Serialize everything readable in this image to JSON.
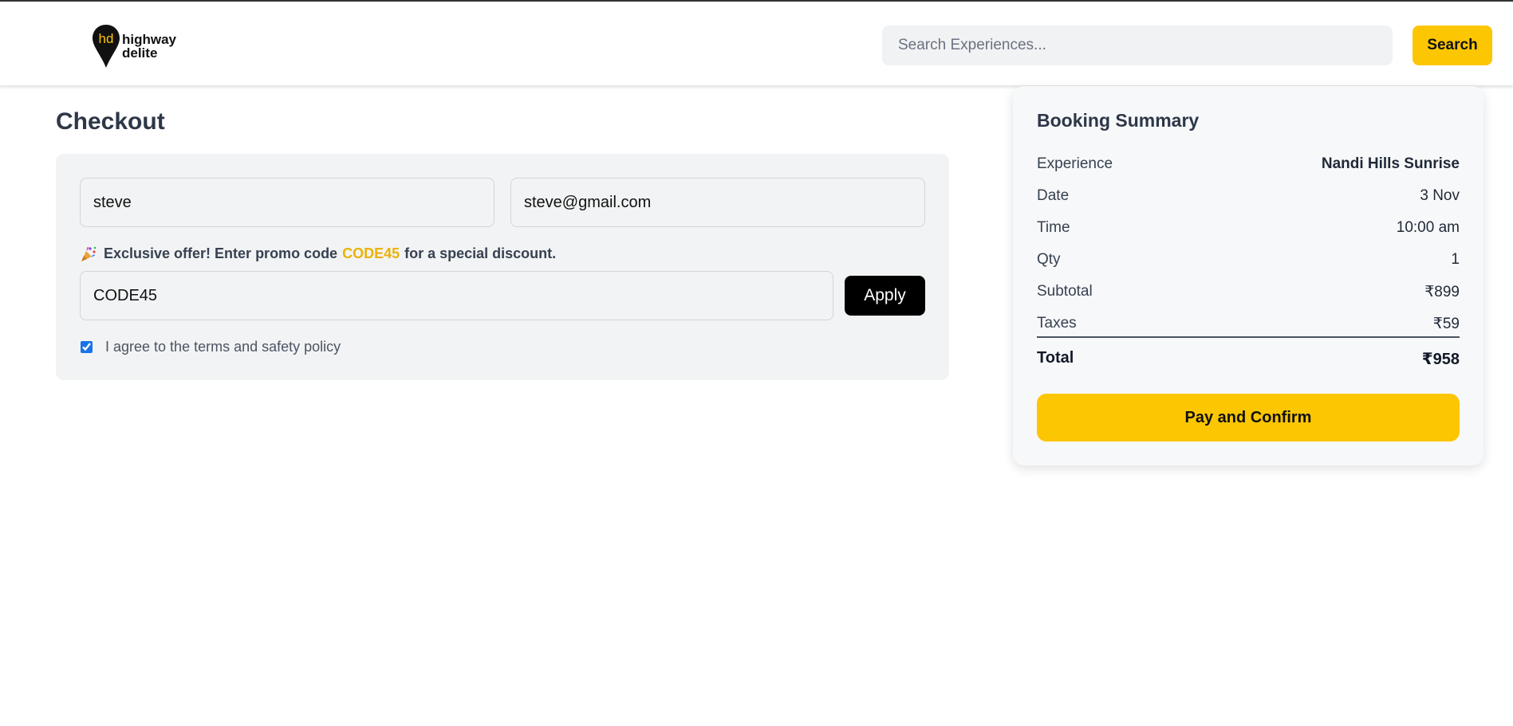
{
  "header": {
    "logo_line1": "highway",
    "logo_line2": "delite",
    "logo_mark": "hd",
    "search_placeholder": "Search Experiences...",
    "search_button_label": "Search"
  },
  "checkout": {
    "title": "Checkout",
    "name_value": "steve",
    "email_value": "steve@gmail.com",
    "promo_note_prefix": "Exclusive offer! Enter promo code",
    "promo_note_code": "CODE45",
    "promo_note_suffix": "for a special discount.",
    "promo_value": "CODE45",
    "apply_label": "Apply",
    "agree_label": "I agree to the terms and safety policy",
    "agree_checked": true
  },
  "summary": {
    "title": "Booking Summary",
    "rows": [
      {
        "label": "Experience",
        "value": "Nandi Hills Sunrise"
      },
      {
        "label": "Date",
        "value": "3 Nov"
      },
      {
        "label": "Time",
        "value": "10:00 am"
      },
      {
        "label": "Qty",
        "value": "1"
      },
      {
        "label": "Subtotal",
        "value": "₹899"
      },
      {
        "label": "Taxes",
        "value": "₹59"
      }
    ],
    "total_label": "Total",
    "total_value": "₹958",
    "pay_label": "Pay and Confirm"
  },
  "colors": {
    "accent": "#fcc603",
    "promo_highlight": "#eab308",
    "apply_bg": "#000000",
    "card_bg": "#f2f3f4"
  },
  "icons": {
    "logo": "map-pin-logo-icon",
    "promo": "party-popper-icon"
  }
}
